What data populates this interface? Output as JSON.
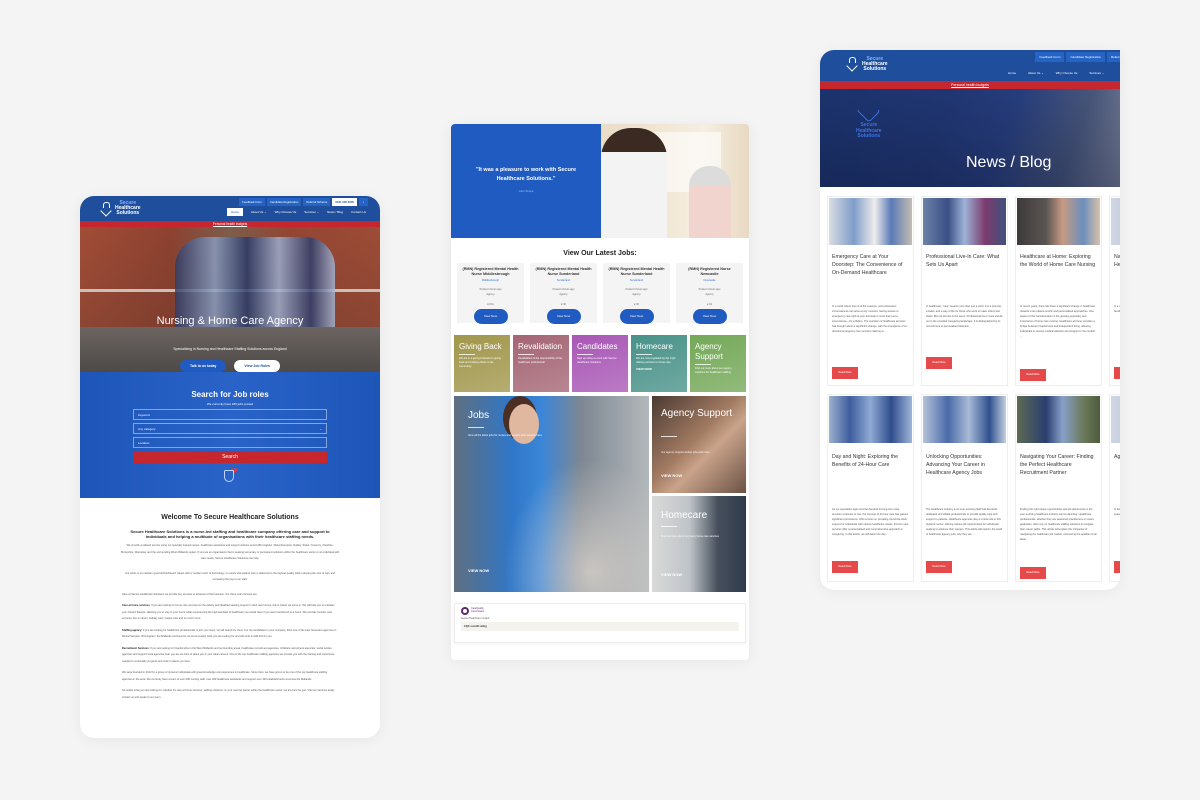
{
  "brand": {
    "name_line1": "Secure",
    "name_line2": "Healthcare",
    "name_line3": "Solutions",
    "primary_color": "#1f4f9c",
    "accent_blue": "#1f5bc0",
    "accent_red": "#c6262e",
    "read_more_red": "#e6494a"
  },
  "home": {
    "top_buttons": [
      "Feedback Form",
      "Candidate Registration",
      "Referral Scheme"
    ],
    "phone": "0191 000 0000",
    "nav": [
      "Home",
      "About Us ⌄",
      "Why Choose Us",
      "Services ⌄",
      "News / Blog",
      "Contact Us"
    ],
    "red_bar_link": "Personal health budgets",
    "hero": {
      "title": "Nursing & Home Care Agency",
      "subtitle": "Specialising in Nursing and Healthcare Staffing Solutions across England",
      "btn_primary": "Talk to us today",
      "btn_secondary": "View Job Roles"
    },
    "search": {
      "title": "Search for Job roles",
      "subtitle": "We currently have 186 jobs posted",
      "keyword_placeholder": "Keyword",
      "category_placeholder": "Any category",
      "location_placeholder": "Location",
      "button": "Search"
    },
    "welcome": {
      "title": "Welcome To Secure Healthcare Solutions",
      "lead": "Secure Healthcare Solutions is a nurse-led staffing and healthcare company offering care and support to individuals and helping a multitude of organisations with their healthcare staffing needs.",
      "p1": "We provide a tailored service using our specially trained nurses, healthcare assistants and support workers across Birmingham, Wolverhampton, Dudley, Stoke, Coventry, Cheshire, Shropshire, Worcester and the surrounding West Midlands region. If you are an organisation that is seeking temporary or permanent solutions within the healthcare sector or an individual with care needs, Secure Healthcare Solutions can help.",
      "p2": "Our ethos is to maintain 'good old fashioned' values with a 'modern twist' of technology, to ensure that patient care is delivered to the highest quality while reducing the cost of care and increasing the pay to our staff.",
      "p3": "Here at Secure Healthcare Solutions we provide key services in all areas of the business. Our three main focuses are:",
      "s1_label": "Care at home services:",
      "s1": "If you are looking for home care services for the elderly and disabled seeking support in their own homes, this is where we come in. We will help you to maintain your chosen lifestyle, allowing you to stay in your home while experiencing the high standard of healthcare you would have if you were transferred to a home. We provide complex care services, live-in carers, holiday care, respite care and so much more.",
      "s2_label": "Staffing agency:",
      "s2": "If you are looking for healthcare professionals to join your team, we will search for them. For top candidates in your company, think one of the best homecare agencies in Wolverhampton, Birmingham, the Midlands and beyond, we know exactly what you are looking for and will work to fulfil this for you.",
      "s3_label": "Recruitment Services:",
      "s3": "If you are looking for hospital jobs in the West Midlands and surrounding areas, healthcare recruitment agencies, childcare recruitment agencies, social worker agencies and support work agencies near you are we here to place you in your ideal careers. One of the top healthcare staffing agencies we provide you with the training and experience needed to continually progress and work in places you love.",
      "p4": "We were founded in 2013 by a group of dynamic individuals with great knowledge and experience in healthcare. Since then, we have grown to be one of the top healthcare staffing agencies in the area. We currently have a team of over 200 nursing staff, over 300 healthcare assistants and support over 100 establishments at across the Midlands.",
      "p5": "No matter what you are looking for, whether it's care at home services, staffing solutions, or your next big career within the healthcare sector, we are here for you. Visit our services today, contact us and speak to our team."
    }
  },
  "middle": {
    "testimonial": {
      "quote": "\"It was a pleasure to work with Secure Healthcare Solutions.\"",
      "author": "John Simpe"
    },
    "jobs_title": "View Our Latest Jobs:",
    "jobs": [
      {
        "title": "(RMN) Registered Mental Health Nurse Middlesbrough",
        "location": "Middlesbrough",
        "posted": "Posted 4 hours ago",
        "type": "Agency",
        "rate": "£ N/A",
        "button": "View Now"
      },
      {
        "title": "(RMN) Registered Mental Health Nurse Sunderland",
        "location": "Sunderland",
        "posted": "Posted 4 hours ago",
        "type": "Agency",
        "rate": "£ 30",
        "button": "View Now"
      },
      {
        "title": "(RMN) Registered Mental Health Nurse Sunderland",
        "location": "Sunderland",
        "posted": "Posted 4 hours ago",
        "type": "Agency",
        "rate": "£ 30",
        "button": "View Now"
      },
      {
        "title": "(RMN) Registered Nurse Newcastle",
        "location": "Newcastle",
        "posted": "Posted 4 hours ago",
        "type": "Agency",
        "rate": "£ 34",
        "button": "View Now"
      }
    ],
    "tiles": [
      {
        "title": "Giving Back",
        "desc": "We are in a giving business in giving back and helping others in the community",
        "cta": "",
        "color": "#9a8f3e"
      },
      {
        "title": "Revalidation",
        "desc": "Revalidation is the responsibility of the healthcare professional",
        "cta": "",
        "color": "#9e5a6a"
      },
      {
        "title": "Candidates",
        "desc": "Sign up today to enrol with Secure Healthcare Solutions",
        "cta": "",
        "color": "#a24bb0"
      },
      {
        "title": "Homecare",
        "desc": "We are now regulated by the CQC offering services to home care",
        "cta": "VIEW NOW",
        "color": "#3b8a80"
      },
      {
        "title": "Agency Support",
        "desc": "Find out more about our agency solutions for healthcare staffing",
        "cta": "",
        "color": "#6aa24c"
      }
    ],
    "features": {
      "jobs": {
        "title": "Jobs",
        "desc": "View all the latest jobs for nurses and support care workers here",
        "cta": "VIEW NOW"
      },
      "agency": {
        "title": "Agency Support",
        "desc": "Our agency support worker jobs and more",
        "cta": "VIEW NOW"
      },
      "homecare": {
        "title": "Homecare",
        "desc": "Find out more about our many home care services",
        "cta": "VIEW NOW"
      }
    },
    "cqc": {
      "logo_line1": "CareQuality",
      "logo_line2": "Commission",
      "company": "Secure Healthcare Limited",
      "rating_label": "CQC overall rating"
    }
  },
  "blog": {
    "top_buttons": [
      "Feedback Form",
      "Candidate Registration",
      "Referral Sc"
    ],
    "nav": [
      "Home",
      "About Us ⌄",
      "Why Choose Us",
      "Services ⌄"
    ],
    "red_bar_link": "Personal health budgets",
    "banner_title": "News / Blog",
    "read_more": "Read More",
    "posts_row1": [
      {
        "title": "Emergency Care at Your Doorstep: The Convenience of On-Demand Healthcare",
        "excerpt": "In a world where time is of the essence, and unforeseen circumstances can arise at any moment, having access to emergency care right at your doorstep is more than just a convenience—it's a lifeline. The evolution of healthcare services has brought about a significant change, with the emergence of on-demand emergency care services catering to ..."
      },
      {
        "title": "Professional Live-In Care: What Sets Us Apart",
        "excerpt": "In healthcare, \"care\" means more than just a word. It is a promise, a belief, and a way of life for those who work to make others feel better. But not all care is the same. Professional live-in care stands out in the crowded caregiving landscape. It is distinguished by its commitment to personalised attention, ..."
      },
      {
        "title": "Healthcare at Home: Exploring the World of Home Care Nursing",
        "excerpt": "In recent years, there has been a significant change in healthcare towards more patient-centric and personalised approaches. One aspect of this transformation is the growing popularity and importance of home care nursing. Healthcare at home provides a bridge between hospital care and independent living, allowing individuals to receive medical attention and support in the comfort ..."
      },
      {
        "title": "Navigating the World of Healthcare",
        "excerpt": "In a rapidly evolving healthcare environment, patients and their families..."
      }
    ],
    "posts_row2": [
      {
        "title": "Day and Night: Exploring the Benefits of 24-Hour Care",
        "excerpt": "As our population ages and the demand for long-term care services continues to rise, the concept of 24-hour care has gained significant prominence. With a focus on providing round-the-clock support for individuals with various healthcare needs, 24-hour care services offer a personalised and comprehensive approach to caregiving. In this article, we will delve into day ..."
      },
      {
        "title": "Unlocking Opportunities: Advancing Your Career in Healthcare Agency Jobs",
        "excerpt": "The healthcare industry is an ever-evolving field that demands dedicated and skilled professionals to provide quality care and support to patients. Healthcare agencies play a crucial role in this dynamic sector, offering various job opportunities for individuals seeking to advance their careers. This article will explore the world of healthcare agency jobs, why they are ..."
      },
      {
        "title": "Navigating Your Career: Finding the Perfect Healthcare Recruitment Partner",
        "excerpt": "Finding the right career opportunities and job placements in the ever-evolving healthcare industry can be daunting. Healthcare professionals, whether they are seasoned practitioners or recent graduates, often rely on healthcare staffing solutions to navigate their career paths. This article will explore the intricacies of navigating the healthcare job market, uncovering the qualities of an ideal ..."
      },
      {
        "title": "Agency Your Healthcare",
        "excerpt": "In the healthcare sector, advancing in your career, whether a seasoned professional..."
      }
    ]
  }
}
